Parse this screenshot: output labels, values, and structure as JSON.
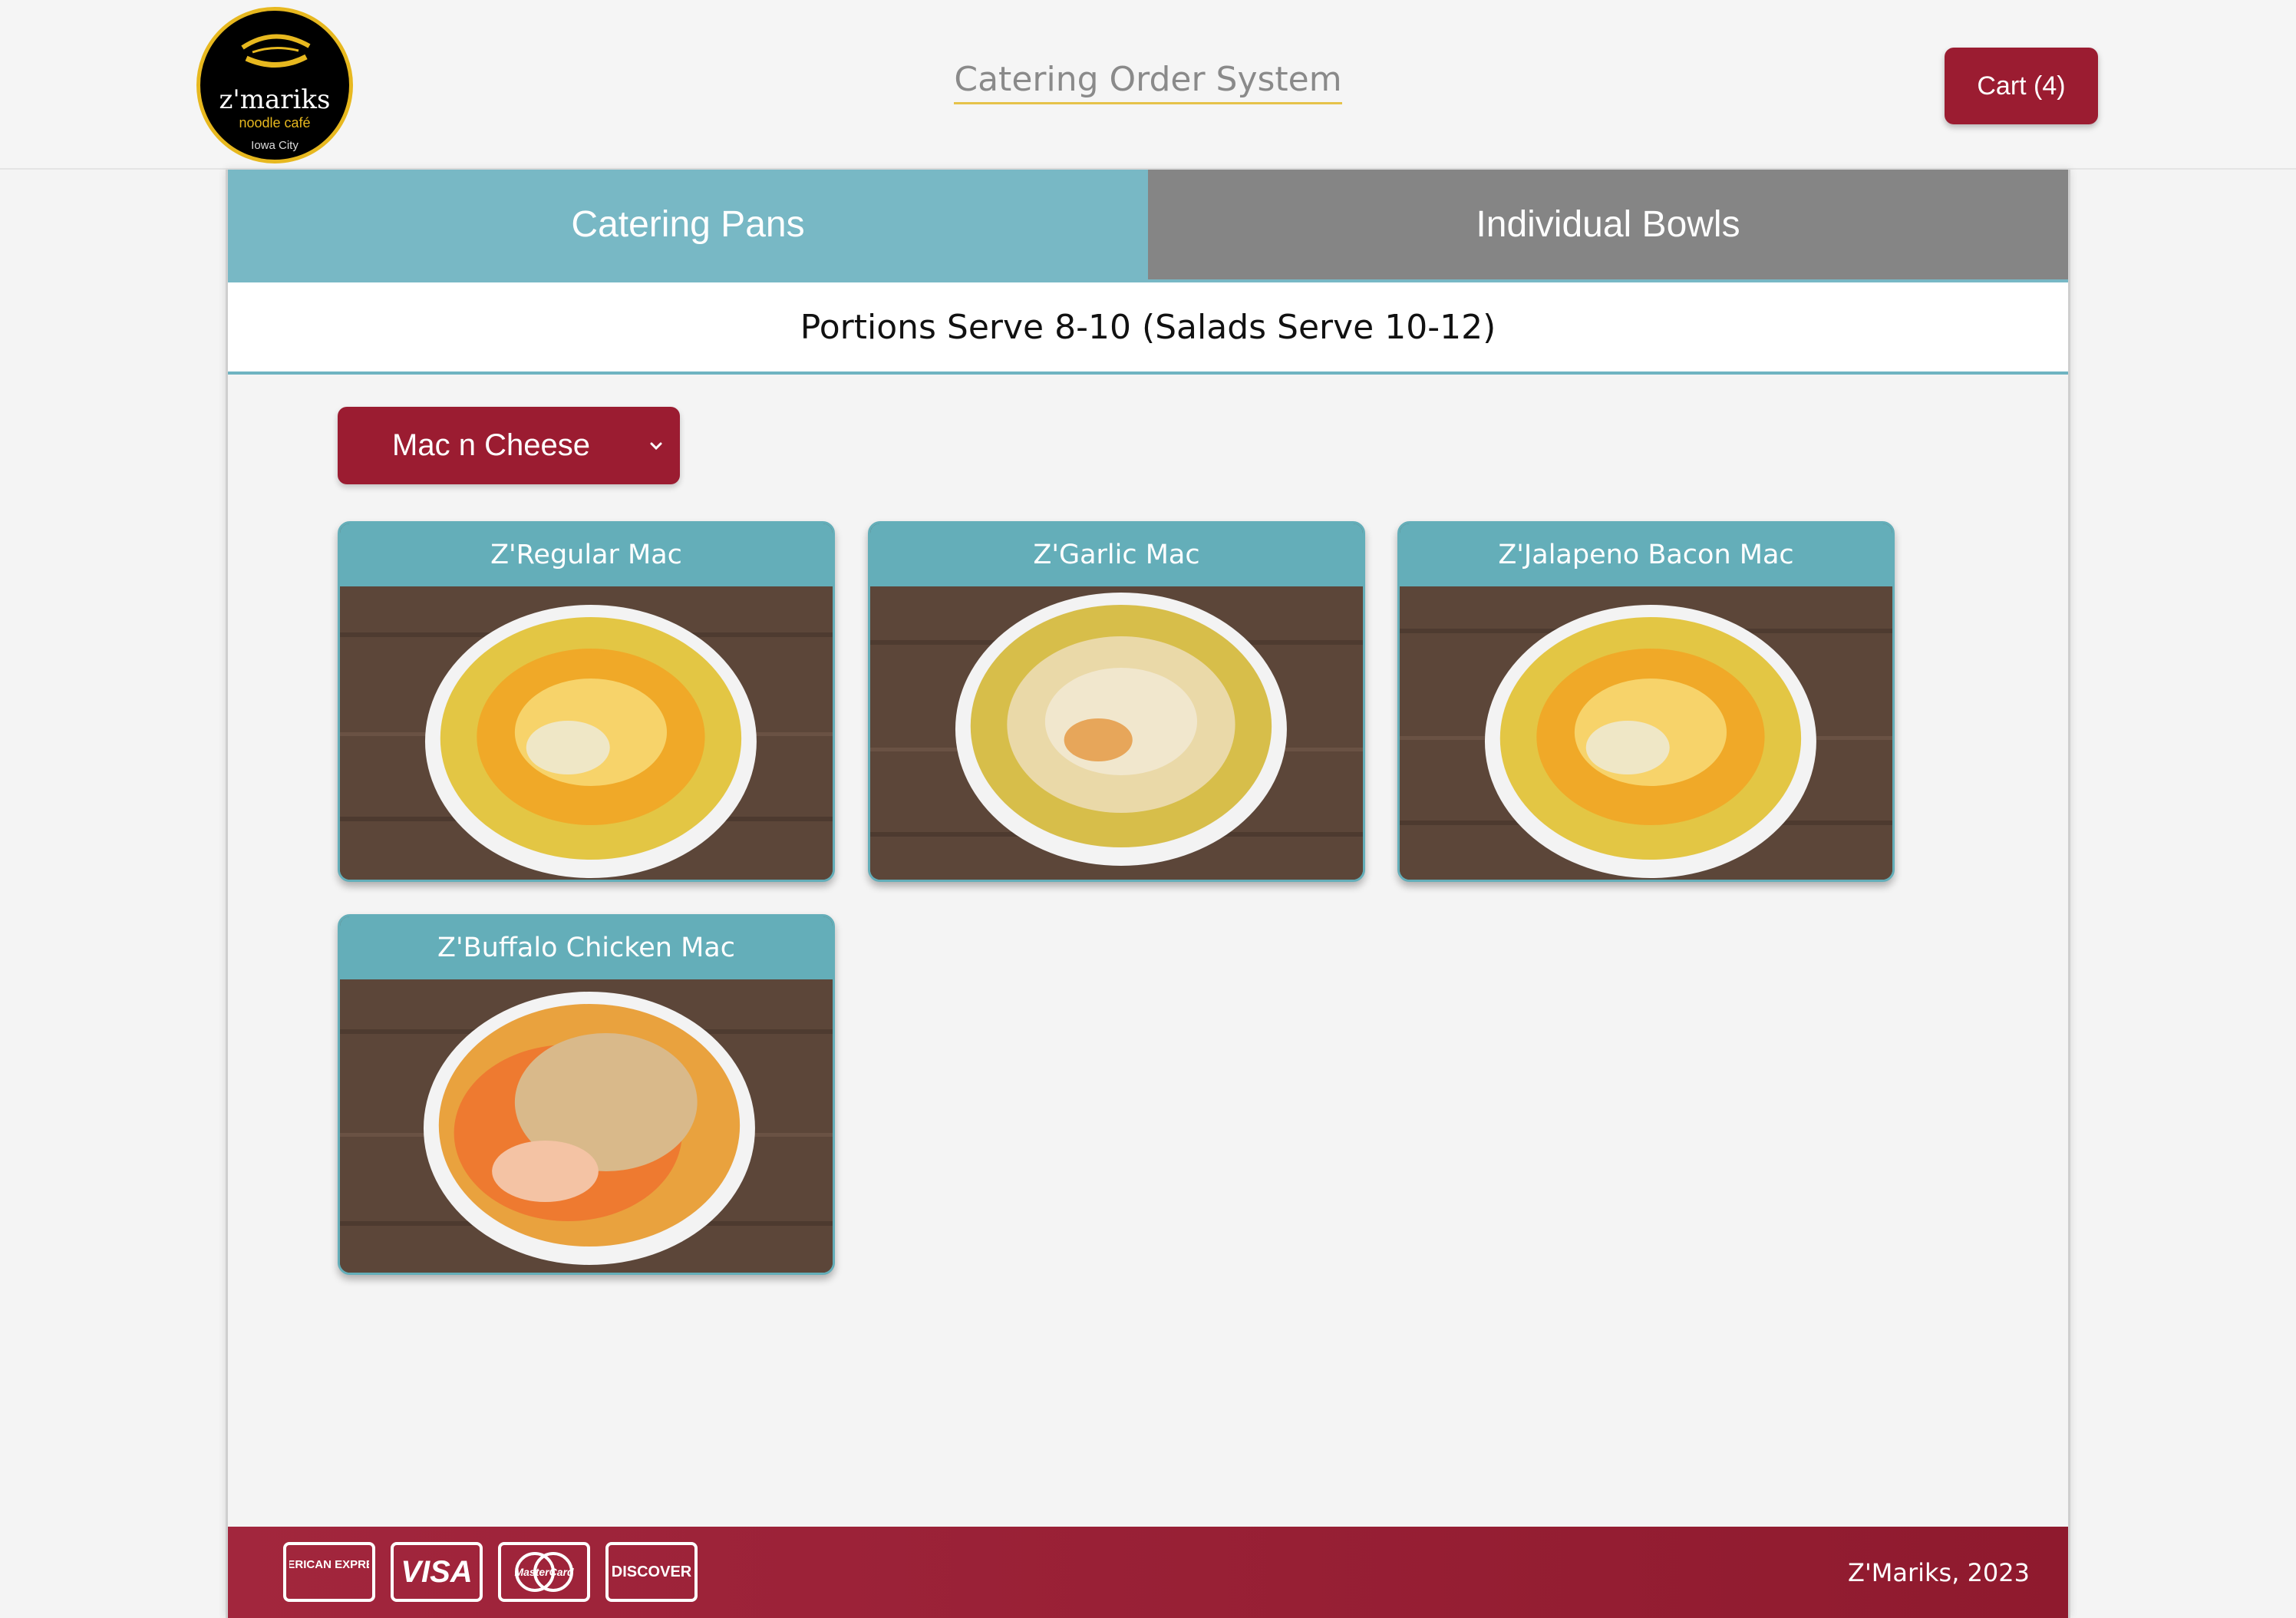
{
  "brand": {
    "logo_name": "z'mariks",
    "logo_sub": "noodle café",
    "logo_city": "Iowa City"
  },
  "header": {
    "title": "Catering Order System",
    "cart_label": "Cart (4)"
  },
  "tabs": [
    {
      "label": "Catering Pans",
      "active": true
    },
    {
      "label": "Individual Bowls",
      "active": false
    }
  ],
  "subheading": "Portions Serve 8-10 (Salads Serve 10-12)",
  "category_select": {
    "selected": "Mac n Cheese",
    "icon": "chevron-down-icon"
  },
  "products": [
    {
      "name": "Z'Regular Mac"
    },
    {
      "name": "Z'Garlic Mac"
    },
    {
      "name": "Z'Jalapeno Bacon Mac"
    },
    {
      "name": "Z'Buffalo Chicken Mac"
    }
  ],
  "footer": {
    "payment_methods": [
      "AMERICAN EXPRESS",
      "VISA",
      "MasterCard",
      "DISCOVER"
    ],
    "copyright": "Z'Mariks, 2023"
  },
  "colors": {
    "brand_red": "#9b1c31",
    "tab_active": "#78b8c5",
    "tab_inactive": "#858585",
    "card_header": "#64aeb9",
    "logo_gold": "#e7b81f"
  }
}
